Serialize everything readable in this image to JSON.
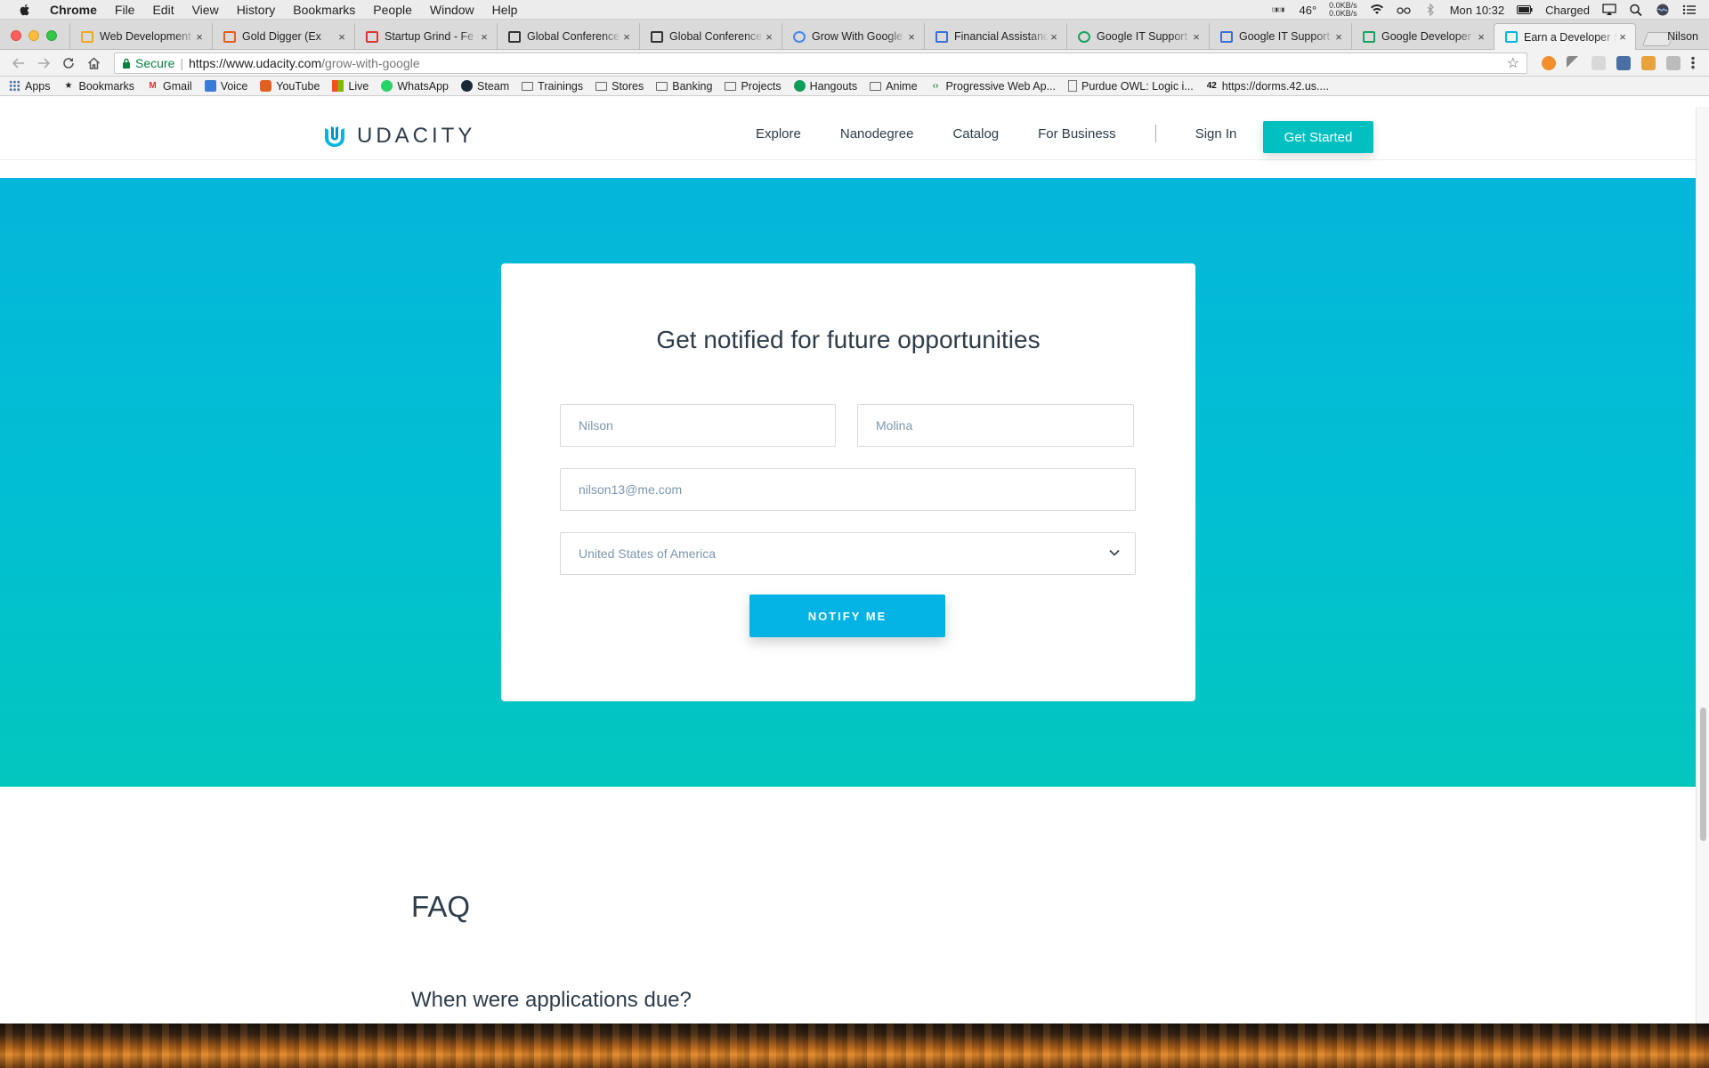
{
  "menubar": {
    "items": [
      "Chrome",
      "File",
      "Edit",
      "View",
      "History",
      "Bookmarks",
      "People",
      "Window",
      "Help"
    ],
    "temperature": "46°",
    "net_up": "0.0KB/s",
    "net_down": "0.0KB/s",
    "clock": "Mon 10:32",
    "battery": "Charged"
  },
  "tabs": [
    {
      "title": "Web Development",
      "favicon": "udacity-u-icon",
      "fav_color": "#f5a623"
    },
    {
      "title": "Gold Digger (Ex",
      "favicon": "youtube-icon",
      "fav_color": "#e06020"
    },
    {
      "title": "Startup Grind - Fe",
      "favicon": "gmail-icon",
      "fav_color": "#d33"
    },
    {
      "title": "Global Conference",
      "favicon": "sg-icon",
      "fav_color": "#333"
    },
    {
      "title": "Global Conference",
      "favicon": "sg-icon",
      "fav_color": "#333"
    },
    {
      "title": "Grow With Google",
      "favicon": "google-g-icon",
      "fav_color": "#4285f4"
    },
    {
      "title": "Financial Assistanc",
      "favicon": "link-icon",
      "fav_color": "#3b6fd8"
    },
    {
      "title": "Google IT Support",
      "favicon": "coursera-icon",
      "fav_color": "#1aa260"
    },
    {
      "title": "Google IT Support",
      "favicon": "link-icon",
      "fav_color": "#3b6fd8"
    },
    {
      "title": "Google Developer",
      "favicon": "dev-icon",
      "fav_color": "#1aa260"
    },
    {
      "title": "Earn a Developer S",
      "favicon": "udacity-u-icon",
      "fav_color": "#02b3e4",
      "active": true
    }
  ],
  "profile_name": "Nilson",
  "address": {
    "secure_label": "Secure",
    "url_host": "https://www.udacity.com",
    "url_path": "/grow-with-google"
  },
  "bookmarks": [
    {
      "label": "Apps",
      "icon": "apps-grid-icon"
    },
    {
      "label": "Bookmarks",
      "icon": "star-icon"
    },
    {
      "label": "Gmail",
      "icon": "gmail-icon"
    },
    {
      "label": "Voice",
      "icon": "voice-icon"
    },
    {
      "label": "YouTube",
      "icon": "youtube-icon"
    },
    {
      "label": "Live",
      "icon": "windows-icon"
    },
    {
      "label": "WhatsApp",
      "icon": "whatsapp-icon"
    },
    {
      "label": "Steam",
      "icon": "steam-icon"
    },
    {
      "label": "Trainings",
      "icon": "folder-icon"
    },
    {
      "label": "Stores",
      "icon": "folder-icon"
    },
    {
      "label": "Banking",
      "icon": "folder-icon"
    },
    {
      "label": "Projects",
      "icon": "folder-icon"
    },
    {
      "label": "Hangouts",
      "icon": "hangouts-icon"
    },
    {
      "label": "Anime",
      "icon": "folder-icon"
    },
    {
      "label": "Progressive Web Ap...",
      "icon": "code-icon"
    },
    {
      "label": "Purdue OWL: Logic i...",
      "icon": "page-icon"
    },
    {
      "label": "https://dorms.42.us....",
      "icon": "42-icon"
    }
  ],
  "site": {
    "logo_text": "UDACITY",
    "nav": [
      "Explore",
      "Nanodegree",
      "Catalog",
      "For Business"
    ],
    "sign_in": "Sign In",
    "get_started": "Get Started",
    "brand_color": "#02b3e4",
    "accent_color": "#02c0c0"
  },
  "form": {
    "title": "Get notified for future opportunities",
    "first_name": "Nilson",
    "last_name": "Molina",
    "email": "nilson13@me.com",
    "country": "United States of America",
    "submit": "NOTIFY ME"
  },
  "faq": {
    "title": "FAQ",
    "first_question": "When were applications due?"
  }
}
